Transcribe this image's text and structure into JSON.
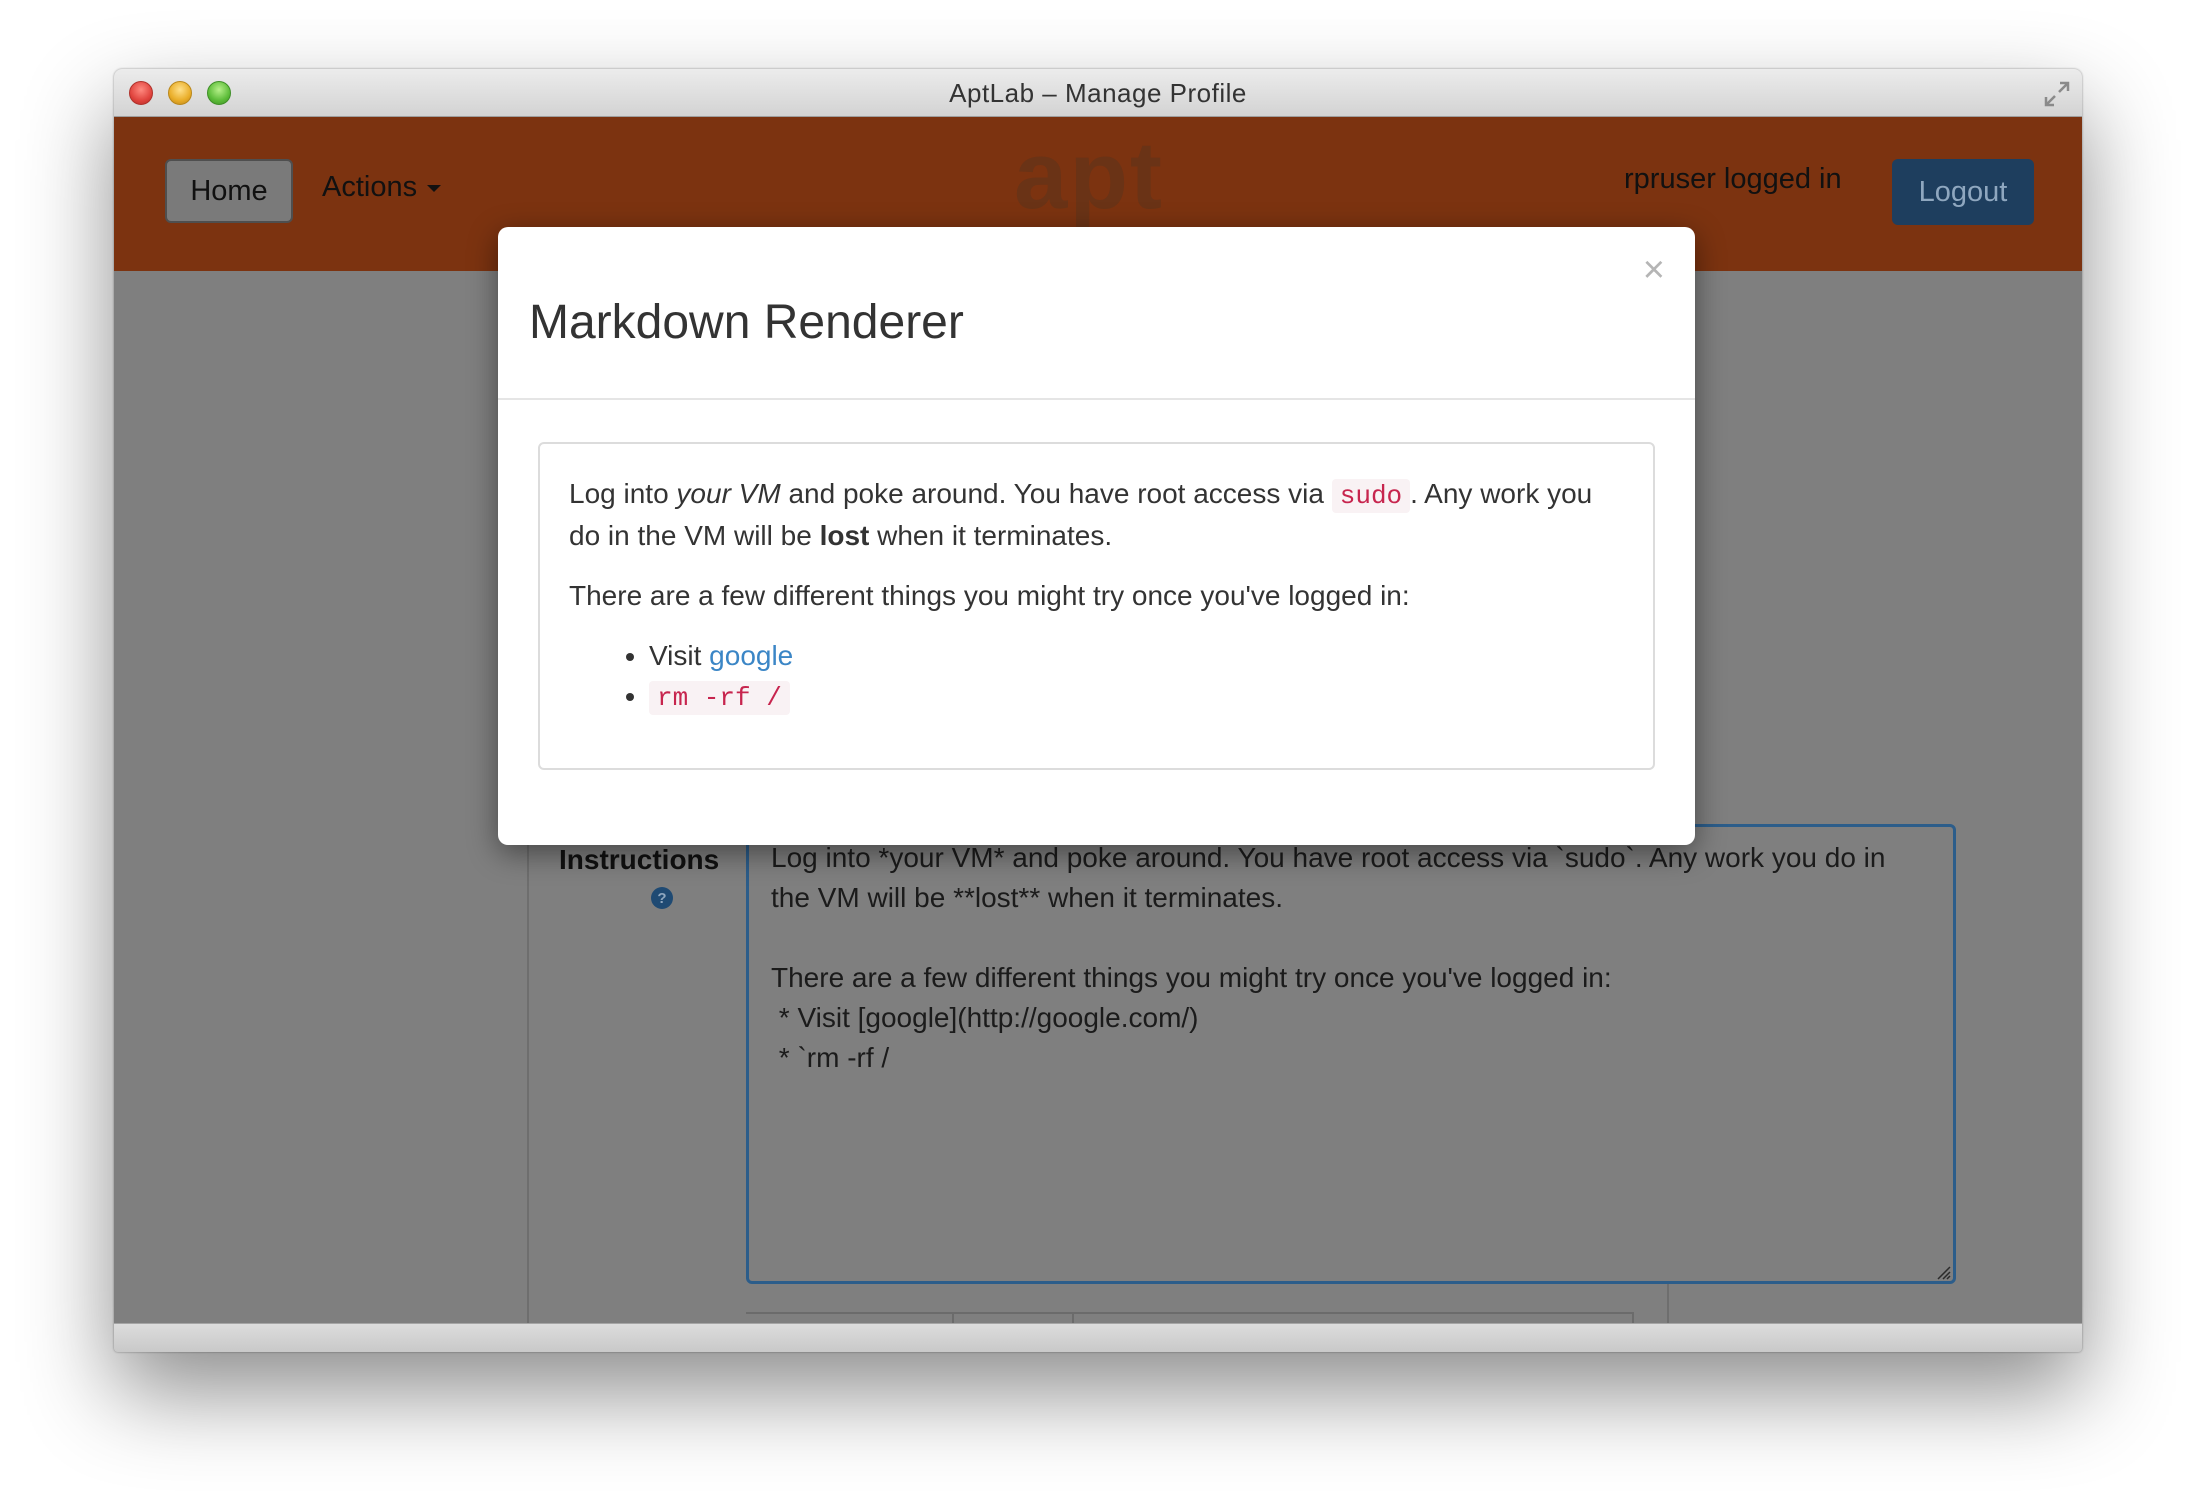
{
  "window": {
    "title": "AptLab – Manage Profile"
  },
  "navbar": {
    "home_label": "Home",
    "actions_label": "Actions",
    "logo_text": "apt",
    "logged_in_text": "rpruser logged in",
    "logout_label": "Logout"
  },
  "form": {
    "instructions_label": "Instructions",
    "instructions_value": "Log into *your VM* and poke around. You have root access via `sudo`. Any work you do in the VM will be **lost** when it terminates.\n\nThere are a few different things you might try once you've logged in:\n * Visit [google](http://google.com/)\n * `rm -rf /"
  },
  "modal": {
    "title": "Markdown Renderer",
    "close_symbol": "×",
    "preview": {
      "p1_part1": "Log into ",
      "p1_em": "your VM",
      "p1_part2": " and poke around. You have root access via ",
      "p1_code": "sudo",
      "p1_part3": ". Any work you do in the VM will be ",
      "p1_strong": "lost",
      "p1_part4": " when it terminates.",
      "p2": "There are a few different things you might try once you've logged in:",
      "li1_text": "Visit ",
      "li1_link": "google",
      "li2_code": "rm -rf /"
    }
  },
  "colors": {
    "navbar": "#7c3310",
    "logout_button": "#1e3e5e",
    "link": "#3b86c6",
    "code": "#c7254e"
  }
}
